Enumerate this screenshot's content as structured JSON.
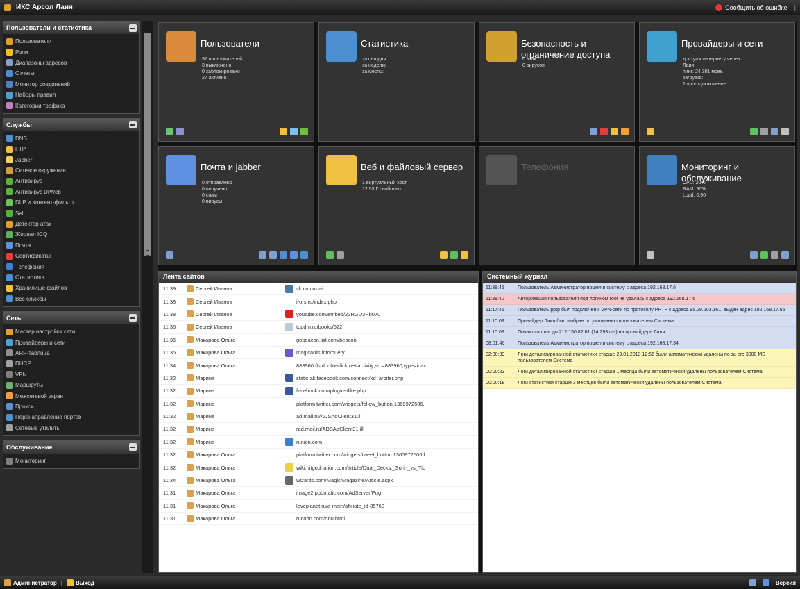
{
  "app": {
    "title": "ИКС Арсол Лаия",
    "report_label": "Сообщить об ошибке"
  },
  "sidebar": [
    {
      "title": "Пользователи и статистика",
      "items": [
        {
          "label": "Пользователи",
          "color": "#e0a030"
        },
        {
          "label": "Роли",
          "color": "#f0c020"
        },
        {
          "label": "Диапазоны адресов",
          "color": "#8aa0c0"
        },
        {
          "label": "Отчеты",
          "color": "#4a8fd0"
        },
        {
          "label": "Монитор соединений",
          "color": "#5080c0"
        },
        {
          "label": "Наборы правил",
          "color": "#50a0d0"
        },
        {
          "label": "Категории трафика",
          "color": "#c080c0"
        }
      ]
    },
    {
      "title": "Службы",
      "items": [
        {
          "label": "DNS",
          "color": "#5090d0"
        },
        {
          "label": "FTP",
          "color": "#f0c040"
        },
        {
          "label": "Jabber",
          "color": "#f0d060"
        },
        {
          "label": "Сетевое окружение",
          "color": "#d0a040"
        },
        {
          "label": "Антивирус",
          "color": "#60b040"
        },
        {
          "label": "Антивирус DrWeb",
          "color": "#60b040"
        },
        {
          "label": "DLP и Контент-фильтр",
          "color": "#70c060"
        },
        {
          "label": "Sell",
          "color": "#50b040"
        },
        {
          "label": "Детектор атак",
          "color": "#e0a030"
        },
        {
          "label": "Жорнал ICQ",
          "color": "#60b060"
        },
        {
          "label": "Почта",
          "color": "#6090e0"
        },
        {
          "label": "Сертификаты",
          "color": "#e04040"
        },
        {
          "label": "Телефония",
          "color": "#4080d0"
        },
        {
          "label": "Статистика",
          "color": "#4a8fd0"
        },
        {
          "label": "Хранилище файлов",
          "color": "#f0c040"
        },
        {
          "label": "Все службы",
          "color": "#5090d0"
        }
      ]
    },
    {
      "title": "Сеть",
      "items": [
        {
          "label": "Мастер настройки сети",
          "color": "#e0a030"
        },
        {
          "label": "Провайдеры и сети",
          "color": "#50a0d0"
        },
        {
          "label": "ARP-таблица",
          "color": "#909090"
        },
        {
          "label": "DHCP",
          "color": "#a0a0a0"
        },
        {
          "label": "VPN",
          "color": "#808080"
        },
        {
          "label": "Маршруты",
          "color": "#70b070"
        },
        {
          "label": "Межсетевой экран",
          "color": "#f0a040"
        },
        {
          "label": "Прокси",
          "color": "#6090d0"
        },
        {
          "label": "Перенаправление портов",
          "color": "#5090d0"
        },
        {
          "label": "Сетевые утилиты",
          "color": "#a0a0a0"
        }
      ]
    },
    {
      "title": "Обслуживание",
      "items": [
        {
          "label": "Мониторинг",
          "color": "#808080"
        }
      ]
    }
  ],
  "tiles": [
    {
      "title": "Пользователи",
      "icon": "users-icon",
      "color": "#d98a3a",
      "lines": [
        "97 пользователей",
        "3 выключено",
        "0 заблокировано",
        "27 активно"
      ],
      "bl": [
        "#70c070",
        "#9090d0"
      ],
      "br": [
        "#f0c040",
        "#80c0f0",
        "#70c040"
      ]
    },
    {
      "title": "Статистика",
      "icon": "stats-icon",
      "color": "#4a8fd0",
      "lines": [
        "за сегодня:",
        "за неделю:",
        "за месяц:"
      ],
      "bl": [],
      "br": []
    },
    {
      "title": "Безопасность и ограничение доступа",
      "icon": "lock-icon",
      "color": "#d0a030",
      "lines": [
        "0 атак",
        "0 вирусов"
      ],
      "bl": [],
      "br": [
        "#80a0d0",
        "#e04040",
        "#f0c040",
        "#f0a030"
      ]
    },
    {
      "title": "Провайдеры и сети",
      "icon": "globe-icon",
      "color": "#40a0d0",
      "lines": [
        "доступ к интернету через:",
        "Лаия",
        "пинг: 24.301 мсек.",
        "загрузка:",
        "1 vpn-подключение"
      ],
      "bl": [
        "#f0c040"
      ],
      "br": [
        "#60c060",
        "#a0a0a0",
        "#80a0d0",
        "#c0c0c0"
      ]
    },
    {
      "title": "Почта и jabber",
      "icon": "mail-icon",
      "color": "#6090e0",
      "lines": [
        "0 отправлено",
        "0 получено",
        "0 спам",
        "0 вирусы"
      ],
      "bl": [
        "#80a0d0"
      ],
      "br": [
        "#80a0d0",
        "#80a0d0",
        "#5090d0",
        "#6090e0",
        "#4a8fd0"
      ]
    },
    {
      "title": "Веб и файловый сервер",
      "icon": "folder-icon",
      "color": "#f0c040",
      "lines": [
        "1 виртуальный хост",
        "12.53 Г свободно"
      ],
      "bl": [
        "#60c060",
        "#a0a0a0"
      ],
      "br": [
        "#f0c040",
        "#60c060",
        "#f0c040"
      ]
    },
    {
      "title": "Телефония",
      "icon": "phone-icon",
      "color": "#555555",
      "disabled": true,
      "lines": [],
      "bl": [],
      "br": []
    },
    {
      "title": "Мониторинг и обслуживание",
      "icon": "monitor-icon",
      "color": "#4080c0",
      "lines": [
        "CPU: 20%",
        "RAM: 90%",
        "Load: 0.90"
      ],
      "bl": [
        "#c0c0c0"
      ],
      "br": [
        "#80a0d0",
        "#60c060",
        "#a0a0a0",
        "#80a0d0"
      ]
    }
  ],
  "feed": {
    "title": "Лента сайтов",
    "rows": [
      {
        "time": "11:39",
        "user": "Сергей Иванов",
        "url": "vk.com/mail",
        "icon": "#4a76a8"
      },
      {
        "time": "11:38",
        "user": "Сергей Иванов",
        "url": "i-ors.ru/index.php",
        "icon": ""
      },
      {
        "time": "11:38",
        "user": "Сергей Иванов",
        "url": "youtube.com/embed/22RGD3Rb070",
        "icon": "#e02020"
      },
      {
        "time": "11:36",
        "user": "Сергей Иванов",
        "url": "topdm.ru/books/622",
        "icon": "#bcd"
      },
      {
        "time": "11:36",
        "user": "Макарова Ольга",
        "url": "gobeacon.lijit.com/beacon",
        "icon": ""
      },
      {
        "time": "11:35",
        "user": "Макарова Ольга",
        "url": "magicards.info/query",
        "icon": "#6a5acd"
      },
      {
        "time": "11:34",
        "user": "Макарова Ольга",
        "url": "883960.fls.doubleclick.net/activity;src=883960;type=inac",
        "icon": ""
      },
      {
        "time": "11:32",
        "user": "Марина",
        "url": "static.ak.facebook.com/connect/xd_arbiter.php",
        "icon": "#3b5998"
      },
      {
        "time": "11:32",
        "user": "Марина",
        "url": "facebook.com/plugins/like.php",
        "icon": "#3b5998"
      },
      {
        "time": "11:32",
        "user": "Марина",
        "url": "platform.twitter.com/widgets/follow_button.1360972506.",
        "icon": ""
      },
      {
        "time": "11:32",
        "user": "Марина",
        "url": "ad.mail.ru/ADSAdClient31.ill",
        "icon": ""
      },
      {
        "time": "11:32",
        "user": "Марина",
        "url": "rad.mail.ru/ADSAdClient31.ill",
        "icon": ""
      },
      {
        "time": "11:32",
        "user": "Марина",
        "url": "runion.com",
        "icon": "#3a7fd0"
      },
      {
        "time": "11:32",
        "user": "Макарова Ольга",
        "url": "platform.twitter.com/widgets/tweet_button.1360972506.l",
        "icon": ""
      },
      {
        "time": "11:32",
        "user": "Макарова Ольга",
        "url": "wiki.nitgodnation.com/article/Dual_Decks:_Sorin_vs_Tib",
        "icon": "#e8d040"
      },
      {
        "time": "11:34",
        "user": "Макарова Ольга",
        "url": "wizards.com/Magic/Magazine/Article.aspx",
        "icon": "#666"
      },
      {
        "time": "11:31",
        "user": "Макарова Ольга",
        "url": "image2.pubmatic.com/AdServer/Pug",
        "icon": ""
      },
      {
        "time": "11:31",
        "user": "Макарова Ольга",
        "url": "loveplanet.ru/a-main/affiliate_id-85763",
        "icon": ""
      },
      {
        "time": "11:31",
        "user": "Макарова Ольга",
        "url": "rucodn.com/on0.html",
        "icon": ""
      }
    ]
  },
  "log": {
    "title": "Системный журнал",
    "rows": [
      {
        "time": "11:38:45",
        "type": "info",
        "text": "Пользователь Администратор вошел в систему с адреса 192.168.17.6"
      },
      {
        "time": "11:38:40",
        "type": "err",
        "text": "Авторизация пользователя под логином root не удалась с адреса 192.168.17.6"
      },
      {
        "time": "11:17:46",
        "type": "info",
        "text": "Пользователь pptp был подключен к VPN-сети по протоколу PPTP с адреса 95.29.203.161, выдан адрес 192.168.17.66"
      },
      {
        "time": "11:10:09",
        "type": "info",
        "text": "Провайдер Лаия был выбран по умолчанию пользователем Система"
      },
      {
        "time": "11:10:09",
        "type": "info",
        "text": "Появился пинг до 212.150.82.61 (14.293 ms) на провайдере Лаия"
      },
      {
        "time": "08:01:46",
        "type": "info",
        "text": "Пользователь Администратор вошел в систему с адреса 192.168.17.34"
      },
      {
        "time": "02:00:09",
        "type": "warn",
        "text": "Логи детализированной статистики старше 23.01.2013 12:56 были автоматически удалены по за его 3000 МБ пользователем Система"
      },
      {
        "time": "00:00:23",
        "type": "warn",
        "text": "Логи детализированной статистики старше 1 месяца были автоматически удалены пользователем Система"
      },
      {
        "time": "00:00:18",
        "type": "warn",
        "text": "Логи статистики старше 3 месяцев были автоматически удалены пользователем Система"
      }
    ]
  },
  "status": {
    "user": "Администратор",
    "logout": "Выход",
    "version": "Версия"
  }
}
